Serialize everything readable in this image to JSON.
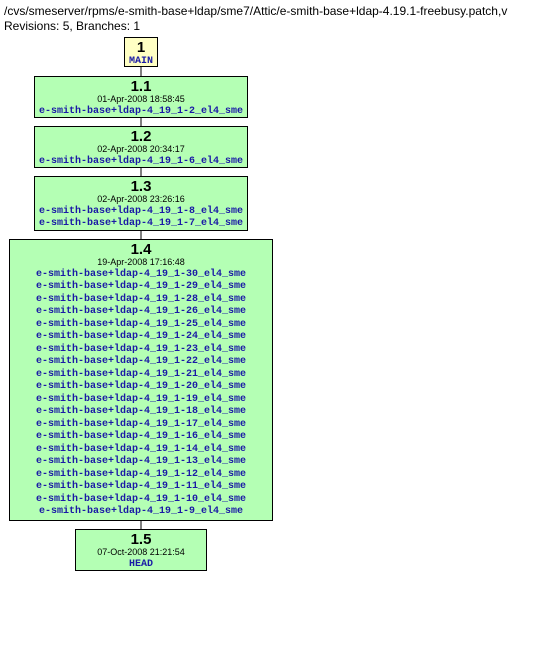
{
  "header": {
    "path": "/cvs/smeserver/rpms/e-smith-base+ldap/sme7/Attic/e-smith-base+ldap-4.19.1-freebusy.patch,v",
    "revisions_label": "Revisions: 5, Branches: 1"
  },
  "nodes": {
    "main": {
      "ver": "1",
      "label": "MAIN"
    },
    "r11": {
      "ver": "1.1",
      "date": "01-Apr-2008 18:58:45",
      "tags": [
        "e-smith-base+ldap-4_19_1-2_el4_sme"
      ]
    },
    "r12": {
      "ver": "1.2",
      "date": "02-Apr-2008 20:34:17",
      "tags": [
        "e-smith-base+ldap-4_19_1-6_el4_sme"
      ]
    },
    "r13": {
      "ver": "1.3",
      "date": "02-Apr-2008 23:26:16",
      "tags": [
        "e-smith-base+ldap-4_19_1-8_el4_sme",
        "e-smith-base+ldap-4_19_1-7_el4_sme"
      ]
    },
    "r14": {
      "ver": "1.4",
      "date": "19-Apr-2008 17:16:48",
      "tags": [
        "e-smith-base+ldap-4_19_1-30_el4_sme",
        "e-smith-base+ldap-4_19_1-29_el4_sme",
        "e-smith-base+ldap-4_19_1-28_el4_sme",
        "e-smith-base+ldap-4_19_1-26_el4_sme",
        "e-smith-base+ldap-4_19_1-25_el4_sme",
        "e-smith-base+ldap-4_19_1-24_el4_sme",
        "e-smith-base+ldap-4_19_1-23_el4_sme",
        "e-smith-base+ldap-4_19_1-22_el4_sme",
        "e-smith-base+ldap-4_19_1-21_el4_sme",
        "e-smith-base+ldap-4_19_1-20_el4_sme",
        "e-smith-base+ldap-4_19_1-19_el4_sme",
        "e-smith-base+ldap-4_19_1-18_el4_sme",
        "e-smith-base+ldap-4_19_1-17_el4_sme",
        "e-smith-base+ldap-4_19_1-16_el4_sme",
        "e-smith-base+ldap-4_19_1-14_el4_sme",
        "e-smith-base+ldap-4_19_1-13_el4_sme",
        "e-smith-base+ldap-4_19_1-12_el4_sme",
        "e-smith-base+ldap-4_19_1-11_el4_sme",
        "e-smith-base+ldap-4_19_1-10_el4_sme",
        "e-smith-base+ldap-4_19_1-9_el4_sme"
      ]
    },
    "r15": {
      "ver": "1.5",
      "date": "07-Oct-2008 21:21:54",
      "tags": [
        "HEAD"
      ]
    }
  }
}
